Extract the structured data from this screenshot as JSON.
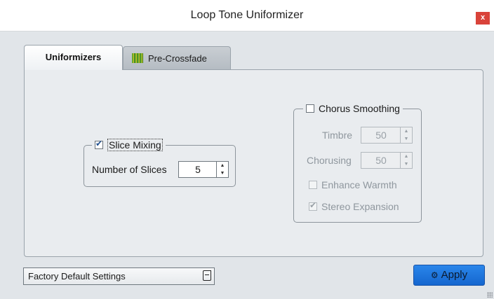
{
  "window": {
    "title": "Loop Tone Uniformizer",
    "close_label": "x"
  },
  "tabs": [
    {
      "label": "Uniformizers",
      "active": true
    },
    {
      "label": "Pre-Crossfade",
      "active": false,
      "icon": "waveform-bars-icon"
    }
  ],
  "slice_mixing": {
    "label": "Slice Mixing",
    "checked": true,
    "slices_label": "Number of Slices",
    "slices_value": "5"
  },
  "chorus_smoothing": {
    "label": "Chorus Smoothing",
    "checked": false,
    "timbre_label": "Timbre",
    "timbre_value": "50",
    "chorusing_label": "Chorusing",
    "chorusing_value": "50",
    "enhance_warmth_label": "Enhance Warmth",
    "enhance_warmth_checked": false,
    "stereo_expansion_label": "Stereo Expansion",
    "stereo_expansion_checked": true
  },
  "footer": {
    "preset_label": "Factory Default Settings",
    "apply_label": "Apply"
  },
  "colors": {
    "apply_bg": "#1e73de",
    "close_bg": "#d9433a"
  }
}
